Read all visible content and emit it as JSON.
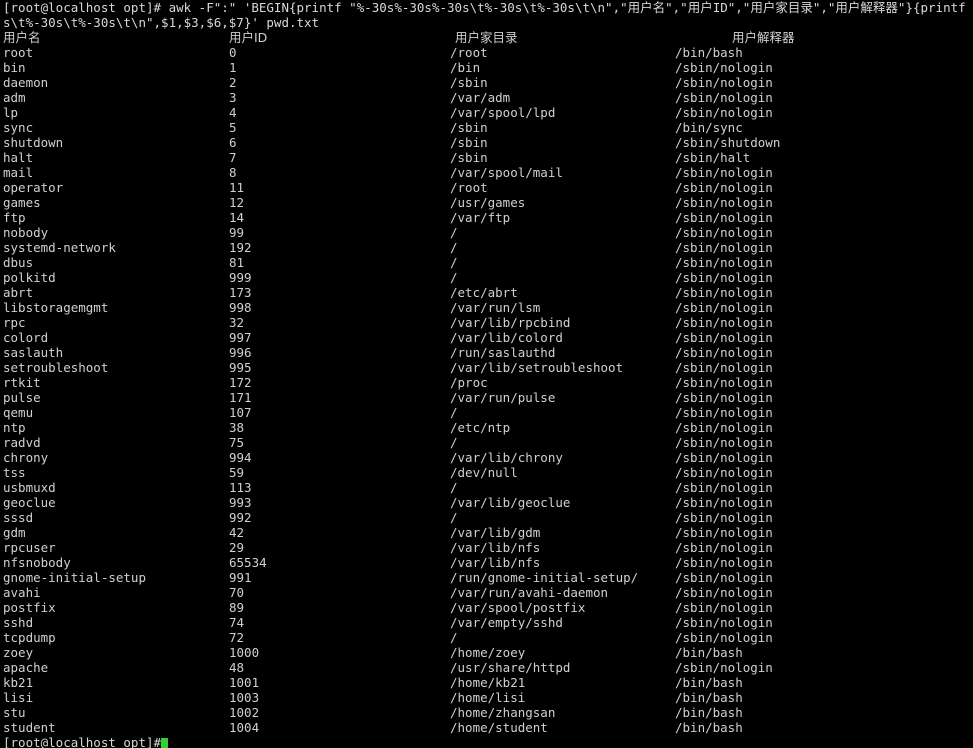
{
  "terminal": {
    "colors": {
      "background": "#000000",
      "foreground": "#d0d0d0",
      "cursor": "#2fd02f"
    },
    "command_lines": [
      "[root@localhost opt]# awk -F\":\" 'BEGIN{printf \"%-30s%-30s%-30s\\t%-30s\\t%-30s\\t\\n\",\"用户名\",\"用户ID\",\"用户家目录\",\"用户解释器\"}{printf \"%-30s\\t%-30s\\t%-30s\\t%-30s\\t\\n\",$1,$3,$6,$7}' pwd.txt",
      "[root@localhost opt]# awk -F\":\" 'BEGIN{printf \"%-30s%-30s%-30s\\t%-30s\\t",
      "s\\t%-30s\\t%-30s\\t\\n\",$1,$3,$6,$7}' pwd.txt"
    ],
    "command_line_1_part_a": "[root@localhost opt]# awk -F\":\" 'BEGIN{printf \"%-30s%-30s%-30s\\t%-30s\\t%-30s\\t\\n\",\"用户名\",\"用户ID\",\"用户家目录\",\"用户解释器\"}{printf \"%-30s\\t%-30",
    "command_line_2": "s\\t%-30s\\t%-30s\\t\\n\",$1,$3,$6,$7}' pwd.txt",
    "prompt_partial": "[root@localhost opt]#"
  },
  "table": {
    "headers": [
      "用户名",
      "用户ID",
      "用户家目录",
      "用户解释器"
    ],
    "rows": [
      [
        "root",
        "0",
        "/root",
        "/bin/bash"
      ],
      [
        "bin",
        "1",
        "/bin",
        "/sbin/nologin"
      ],
      [
        "daemon",
        "2",
        "/sbin",
        "/sbin/nologin"
      ],
      [
        "adm",
        "3",
        "/var/adm",
        "/sbin/nologin"
      ],
      [
        "lp",
        "4",
        "/var/spool/lpd",
        "/sbin/nologin"
      ],
      [
        "sync",
        "5",
        "/sbin",
        "/bin/sync"
      ],
      [
        "shutdown",
        "6",
        "/sbin",
        "/sbin/shutdown"
      ],
      [
        "halt",
        "7",
        "/sbin",
        "/sbin/halt"
      ],
      [
        "mail",
        "8",
        "/var/spool/mail",
        "/sbin/nologin"
      ],
      [
        "operator",
        "11",
        "/root",
        "/sbin/nologin"
      ],
      [
        "games",
        "12",
        "/usr/games",
        "/sbin/nologin"
      ],
      [
        "ftp",
        "14",
        "/var/ftp",
        "/sbin/nologin"
      ],
      [
        "nobody",
        "99",
        "/",
        "/sbin/nologin"
      ],
      [
        "systemd-network",
        "192",
        "/",
        "/sbin/nologin"
      ],
      [
        "dbus",
        "81",
        "/",
        "/sbin/nologin"
      ],
      [
        "polkitd",
        "999",
        "/",
        "/sbin/nologin"
      ],
      [
        "abrt",
        "173",
        "/etc/abrt",
        "/sbin/nologin"
      ],
      [
        "libstoragemgmt",
        "998",
        "/var/run/lsm",
        "/sbin/nologin"
      ],
      [
        "rpc",
        "32",
        "/var/lib/rpcbind",
        "/sbin/nologin"
      ],
      [
        "colord",
        "997",
        "/var/lib/colord",
        "/sbin/nologin"
      ],
      [
        "saslauth",
        "996",
        "/run/saslauthd",
        "/sbin/nologin"
      ],
      [
        "setroubleshoot",
        "995",
        "/var/lib/setroubleshoot",
        "/sbin/nologin"
      ],
      [
        "rtkit",
        "172",
        "/proc",
        "/sbin/nologin"
      ],
      [
        "pulse",
        "171",
        "/var/run/pulse",
        "/sbin/nologin"
      ],
      [
        "qemu",
        "107",
        "/",
        "/sbin/nologin"
      ],
      [
        "ntp",
        "38",
        "/etc/ntp",
        "/sbin/nologin"
      ],
      [
        "radvd",
        "75",
        "/",
        "/sbin/nologin"
      ],
      [
        "chrony",
        "994",
        "/var/lib/chrony",
        "/sbin/nologin"
      ],
      [
        "tss",
        "59",
        "/dev/null",
        "/sbin/nologin"
      ],
      [
        "usbmuxd",
        "113",
        "/",
        "/sbin/nologin"
      ],
      [
        "geoclue",
        "993",
        "/var/lib/geoclue",
        "/sbin/nologin"
      ],
      [
        "sssd",
        "992",
        "/",
        "/sbin/nologin"
      ],
      [
        "gdm",
        "42",
        "/var/lib/gdm",
        "/sbin/nologin"
      ],
      [
        "rpcuser",
        "29",
        "/var/lib/nfs",
        "/sbin/nologin"
      ],
      [
        "nfsnobody",
        "65534",
        "/var/lib/nfs",
        "/sbin/nologin"
      ],
      [
        "gnome-initial-setup",
        "991",
        "/run/gnome-initial-setup/",
        "/sbin/nologin"
      ],
      [
        "avahi",
        "70",
        "/var/run/avahi-daemon",
        "/sbin/nologin"
      ],
      [
        "postfix",
        "89",
        "/var/spool/postfix",
        "/sbin/nologin"
      ],
      [
        "sshd",
        "74",
        "/var/empty/sshd",
        "/sbin/nologin"
      ],
      [
        "tcpdump",
        "72",
        "/",
        "/sbin/nologin"
      ],
      [
        "zoey",
        "1000",
        "/home/zoey",
        "/bin/bash"
      ],
      [
        "apache",
        "48",
        "/usr/share/httpd",
        "/sbin/nologin"
      ],
      [
        "kb21",
        "1001",
        "/home/kb21",
        "/bin/bash"
      ],
      [
        "lisi",
        "1003",
        "/home/lisi",
        "/bin/bash"
      ],
      [
        "stu",
        "1002",
        "/home/zhangsan",
        "/bin/bash"
      ],
      [
        "student",
        "1004",
        "/home/student",
        "/bin/bash"
      ]
    ]
  }
}
